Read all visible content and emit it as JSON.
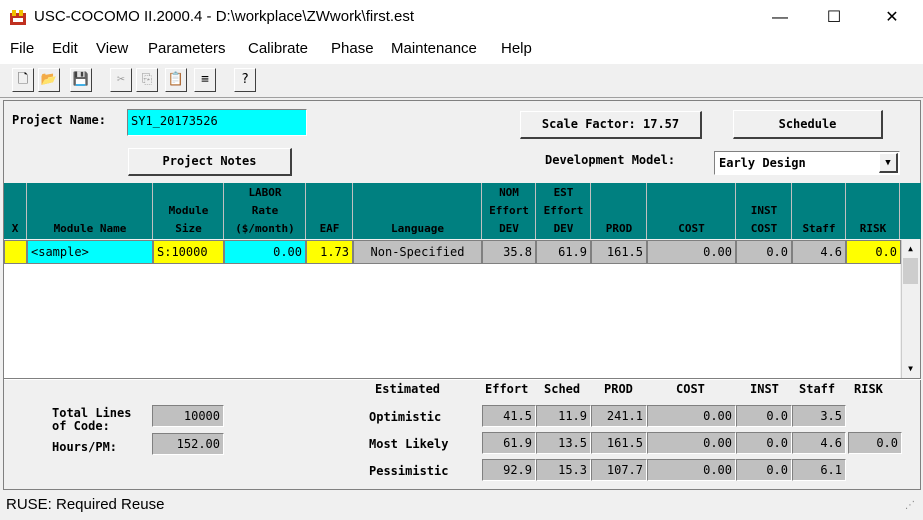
{
  "window": {
    "title": "USC-COCOMO II.2000.4 - D:\\workplace\\ZWwork\\first.est",
    "minimize": "—",
    "maximize": "☐",
    "close": "✕"
  },
  "menu": [
    "File",
    "Edit",
    "View",
    "Parameters",
    "Calibrate",
    "Phase",
    "Maintenance",
    "Help"
  ],
  "toolbar": [
    "🗋",
    "📂",
    "💾",
    "✂",
    "⎘",
    "📋",
    "≡",
    "?"
  ],
  "project": {
    "name_label": "Project Name:",
    "name_value": "SY1_20173526",
    "scale_factor_label": "Scale Factor: 17.57",
    "schedule_label": "Schedule",
    "notes_label": "Project Notes",
    "dev_model_label": "Development Model:",
    "dev_model_value": "Early Design"
  },
  "table": {
    "headers": [
      [
        "X"
      ],
      [
        "Module Name"
      ],
      [
        "Module",
        "Size"
      ],
      [
        "LABOR",
        "Rate",
        "($/month)"
      ],
      [
        "EAF"
      ],
      [
        "Language"
      ],
      [
        "NOM",
        "Effort",
        "DEV"
      ],
      [
        "EST",
        "Effort",
        "DEV"
      ],
      [
        "PROD"
      ],
      [
        "COST"
      ],
      [
        "INST",
        "COST"
      ],
      [
        "Staff"
      ],
      [
        "RISK"
      ]
    ],
    "row": {
      "x": "",
      "module_name": "<sample>",
      "size": "S:10000",
      "labor_rate": "0.00",
      "eaf": "1.73",
      "language": "Non-Specified",
      "nom_effort": "35.8",
      "est_effort": "61.9",
      "prod": "161.5",
      "cost": "0.00",
      "inst_cost": "0.0",
      "staff": "4.6",
      "risk": "0.0"
    }
  },
  "summary": {
    "headers": [
      "Estimated",
      "Effort",
      "Sched",
      "PROD",
      "COST",
      "INST",
      "Staff",
      "RISK"
    ],
    "total_loc_label": "Total Lines of Code:",
    "total_loc_value": "10000",
    "hours_label": "Hours/PM:",
    "hours_value": "152.00",
    "rows": [
      {
        "label": "Optimistic",
        "effort": "41.5",
        "sched": "11.9",
        "prod": "241.1",
        "cost": "0.00",
        "inst": "0.0",
        "staff": "3.5",
        "risk": ""
      },
      {
        "label": "Most Likely",
        "effort": "61.9",
        "sched": "13.5",
        "prod": "161.5",
        "cost": "0.00",
        "inst": "0.0",
        "staff": "4.6",
        "risk": "0.0"
      },
      {
        "label": "Pessimistic",
        "effort": "92.9",
        "sched": "15.3",
        "prod": "107.7",
        "cost": "0.00",
        "inst": "0.0",
        "staff": "6.1",
        "risk": ""
      }
    ]
  },
  "status": "RUSE: Required Reuse"
}
